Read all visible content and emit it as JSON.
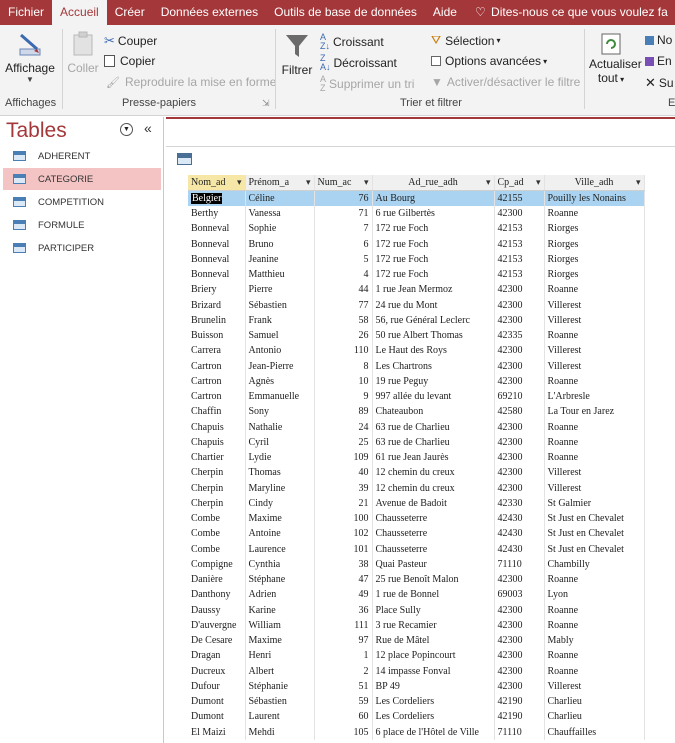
{
  "tabs": [
    "Fichier",
    "Accueil",
    "Créer",
    "Données externes",
    "Outils de base de données",
    "Aide",
    "Dites-nous ce que vous voulez fa"
  ],
  "ribbon": {
    "affichage": "Affichage",
    "coller": "Coller",
    "couper": "Couper",
    "copier": "Copier",
    "reproduire": "Reproduire la mise en forme",
    "filtrer": "Filtrer",
    "croissant": "Croissant",
    "decroissant": "Décroissant",
    "supprimer_tri": "Supprimer un tri",
    "selection": "Sélection",
    "options": "Options avancées",
    "activer": "Activer/désactiver le filtre",
    "actualiser": "Actualiser",
    "tout": "tout",
    "nouveau": "No",
    "enregistrer": "En",
    "supprimer": "Su",
    "g_affichages": "Affichages",
    "g_presse": "Presse-papiers",
    "g_trier": "Trier et filtrer",
    "g_e": "E"
  },
  "nav": {
    "title": "Tables",
    "items": [
      "ADHERENT",
      "CATEGORIE",
      "COMPETITION",
      "FORMULE",
      "PARTICIPER"
    ],
    "selected": 1
  },
  "table": {
    "columns": [
      "Nom_ad",
      "Prénom_a",
      "Num_ac",
      "Ad_rue_adh",
      "Cp_ad",
      "Ville_adh"
    ],
    "rows": [
      [
        "Belgier",
        "Céline",
        "76",
        "Au Bourg",
        "42155",
        "Pouilly les Nonains"
      ],
      [
        "Berthy",
        "Vanessa",
        "71",
        "6 rue Gilbertès",
        "42300",
        "Roanne"
      ],
      [
        "Bonneval",
        "Sophie",
        "7",
        "172 rue Foch",
        "42153",
        "Riorges"
      ],
      [
        "Bonneval",
        "Bruno",
        "6",
        "172 rue Foch",
        "42153",
        "Riorges"
      ],
      [
        "Bonneval",
        "Jeanine",
        "5",
        "172 rue Foch",
        "42153",
        "Riorges"
      ],
      [
        "Bonneval",
        "Matthieu",
        "4",
        "172 rue Foch",
        "42153",
        "Riorges"
      ],
      [
        "Briery",
        "Pierre",
        "44",
        "1 rue Jean Mermoz",
        "42300",
        "Roanne"
      ],
      [
        "Brizard",
        "Sébastien",
        "77",
        "24 rue du Mont",
        "42300",
        "Villerest"
      ],
      [
        "Brunelin",
        "Frank",
        "58",
        "56, rue Général Leclerc",
        "42300",
        "Villerest"
      ],
      [
        "Buisson",
        "Samuel",
        "26",
        "50 rue Albert Thomas",
        "42335",
        "Roanne"
      ],
      [
        "Carrera",
        "Antonio",
        "110",
        "Le Haut des Roys",
        "42300",
        "Villerest"
      ],
      [
        "Cartron",
        "Jean-Pierre",
        "8",
        "Les Chartrons",
        "42300",
        "Villerest"
      ],
      [
        "Cartron",
        "Agnès",
        "10",
        "19 rue Peguy",
        "42300",
        "Roanne"
      ],
      [
        "Cartron",
        "Emmanuelle",
        "9",
        "997 allée du levant",
        "69210",
        "L'Arbresle"
      ],
      [
        "Chaffin",
        "Sony",
        "89",
        "Chateaubon",
        "42580",
        "La Tour en Jarez"
      ],
      [
        "Chapuis",
        "Nathalie",
        "24",
        "63 rue de Charlieu",
        "42300",
        "Roanne"
      ],
      [
        "Chapuis",
        "Cyril",
        "25",
        "63 rue de Charlieu",
        "42300",
        "Roanne"
      ],
      [
        "Chartier",
        "Lydie",
        "109",
        "61 rue Jean Jaurès",
        "42300",
        "Roanne"
      ],
      [
        "Cherpin",
        "Thomas",
        "40",
        "12 chemin du creux",
        "42300",
        "Villerest"
      ],
      [
        "Cherpin",
        "Maryline",
        "39",
        "12 chemin du creux",
        "42300",
        "Villerest"
      ],
      [
        "Cherpin",
        "Cindy",
        "21",
        "Avenue de Badoit",
        "42330",
        "St Galmier"
      ],
      [
        "Combe",
        "Maxime",
        "100",
        "Chausseterre",
        "42430",
        "St Just en Chevalet"
      ],
      [
        "Combe",
        "Antoine",
        "102",
        "Chausseterre",
        "42430",
        "St Just en Chevalet"
      ],
      [
        "Combe",
        "Laurence",
        "101",
        "Chausseterre",
        "42430",
        "St Just en Chevalet"
      ],
      [
        "Compigne",
        "Cynthia",
        "38",
        "Quai Pasteur",
        "71110",
        "Chambilly"
      ],
      [
        "Danière",
        "Stéphane",
        "47",
        "25 rue Benoît Malon",
        "42300",
        "Roanne"
      ],
      [
        "Danthony",
        "Adrien",
        "49",
        "1 rue de Bonnel",
        "69003",
        "Lyon"
      ],
      [
        "Daussy",
        "Karine",
        "36",
        "Place Sully",
        "42300",
        "Roanne"
      ],
      [
        "D'auvergne",
        "William",
        "111",
        "3 rue Recamier",
        "42300",
        "Roanne"
      ],
      [
        "De Cesare",
        "Maxime",
        "97",
        "Rue de Mâtel",
        "42300",
        "Mably"
      ],
      [
        "Dragan",
        "Henri",
        "1",
        "12 place Popincourt",
        "42300",
        "Roanne"
      ],
      [
        "Ducreux",
        "Albert",
        "2",
        "14 impasse Fonval",
        "42300",
        "Roanne"
      ],
      [
        "Dufour",
        "Stéphanie",
        "51",
        "BP 49",
        "42300",
        "Villerest"
      ],
      [
        "Dumont",
        "Sébastien",
        "59",
        "Les Cordeliers",
        "42190",
        "Charlieu"
      ],
      [
        "Dumont",
        "Laurent",
        "60",
        "Les Cordeliers",
        "42190",
        "Charlieu"
      ],
      [
        "El Maizi",
        "Mehdi",
        "105",
        "6 place de l'Hôtel de Ville",
        "71110",
        "Chauffailles"
      ]
    ]
  },
  "colors": {
    "accent": "#a4373a",
    "selected_row": "#a9d3f0",
    "nav_selected": "#f4c3c3"
  }
}
